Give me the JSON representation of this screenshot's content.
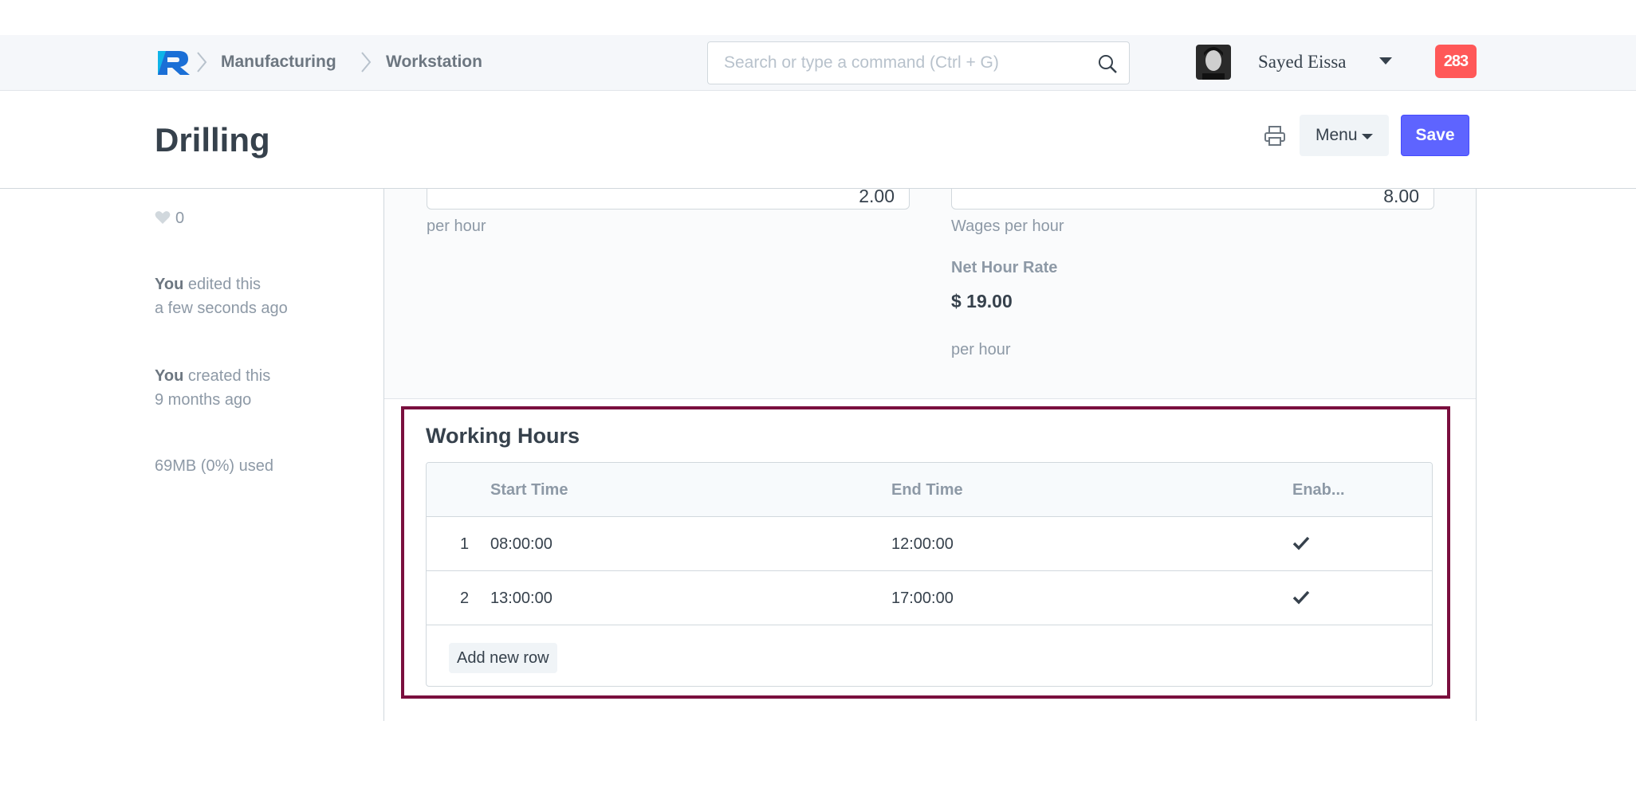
{
  "navbar": {
    "breadcrumbs": [
      "Manufacturing",
      "Workstation"
    ],
    "search_placeholder": "Search or type a command (Ctrl + G)",
    "user_name": "Sayed Eissa",
    "notification_count": "283"
  },
  "page": {
    "title": "Drilling",
    "menu_label": "Menu",
    "save_label": "Save"
  },
  "sidebar": {
    "likes": "0",
    "edited_by": "You",
    "edited_action": "edited this",
    "edited_time": "a few seconds ago",
    "created_by": "You",
    "created_action": "created this",
    "created_time": "9 months ago",
    "storage": "69MB (0%) used"
  },
  "form": {
    "left_field_value": "2.00",
    "left_field_desc": "per hour",
    "right_field_value": "8.00",
    "right_field_desc": "Wages per hour",
    "net_hour_rate_label": "Net Hour Rate",
    "net_hour_rate_value": "$ 19.00",
    "net_hour_rate_desc": "per hour"
  },
  "working_hours": {
    "title": "Working Hours",
    "columns": [
      "Start Time",
      "End Time",
      "Enab..."
    ],
    "rows": [
      {
        "idx": "1",
        "start": "08:00:00",
        "end": "12:00:00",
        "enabled": true
      },
      {
        "idx": "2",
        "start": "13:00:00",
        "end": "17:00:00",
        "enabled": true
      }
    ],
    "add_row_label": "Add new row"
  },
  "colors": {
    "primary": "#5e64ff",
    "badge": "#ff5858",
    "highlight_border": "#7a0f3e"
  }
}
